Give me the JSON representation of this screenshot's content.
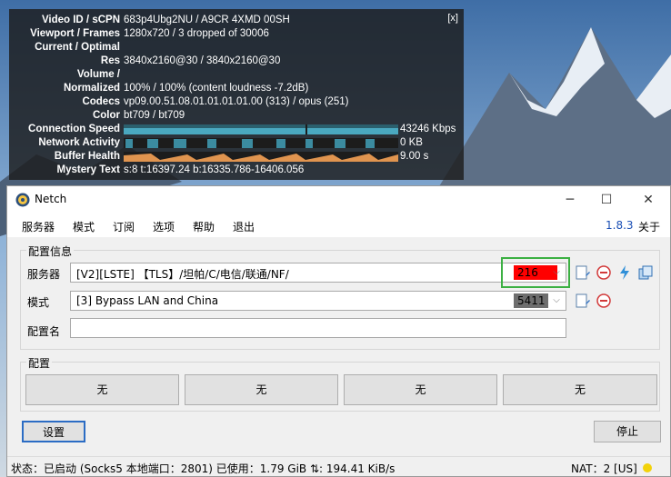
{
  "stats_overlay": {
    "close_label": "[x]",
    "rows": [
      {
        "label": "Video ID / sCPN",
        "value": "683p4Ubg2NU / A9CR 4XMD 00SH"
      },
      {
        "label": "Viewport / Frames",
        "value": "1280x720 / 3 dropped of 30006"
      },
      {
        "label": "Current / Optimal",
        "value": ""
      },
      {
        "label": "Res",
        "value": "3840x2160@30 / 3840x2160@30"
      },
      {
        "label": "Volume /",
        "value": ""
      },
      {
        "label": "Normalized",
        "value": "100% / 100% (content loudness -7.2dB)"
      },
      {
        "label": "Codecs",
        "value": "vp09.00.51.08.01.01.01.01.00 (313) / opus (251)"
      },
      {
        "label": "Color",
        "value": "bt709 / bt709"
      },
      {
        "label": "Connection Speed",
        "value": "43246 Kbps"
      },
      {
        "label": "Network Activity",
        "value": "0 KB"
      },
      {
        "label": "Buffer Health",
        "value": "9.00 s"
      },
      {
        "label": "Mystery Text",
        "value": "s:8 t:16397.24 b:16335.786-16406.056"
      }
    ]
  },
  "window": {
    "title": "Netch",
    "app_icon": "netch-logo-icon",
    "controls": [
      "minimize-icon",
      "maximize-icon",
      "close-icon"
    ]
  },
  "menu": {
    "items": [
      "服务器",
      "模式",
      "订阅",
      "选项",
      "帮助",
      "退出"
    ],
    "version": "1.8.3",
    "about": "关于"
  },
  "config": {
    "group_title": "配置信息",
    "server_label": "服务器",
    "server_value": "[V2][LSTE] 【TLS】/坦帕/C/电信/联通/NF/",
    "server_latency": "216",
    "mode_label": "模式",
    "mode_value": "[3] Bypass LAN and China",
    "mode_count": "5411",
    "profile_label": "配置名",
    "profile_value": ""
  },
  "profiles": {
    "group_title": "配置",
    "buttons": [
      "无",
      "无",
      "无",
      "无"
    ]
  },
  "actions": {
    "settings": "设置",
    "stop": "停止"
  },
  "statusbar": {
    "text": "状态：已启动 (Socks5 本地端口：2801)  已使用：1.79 GiB  ⇅: 194.41 KiB/s",
    "nat": "NAT：2 [US]"
  },
  "colors": {
    "latency_bg": "#ff0000",
    "highlight_box": "#3cb043",
    "count_bg": "#6e6e6e",
    "version": "#1a4fb5",
    "nat_dot": "#f2d20a"
  }
}
